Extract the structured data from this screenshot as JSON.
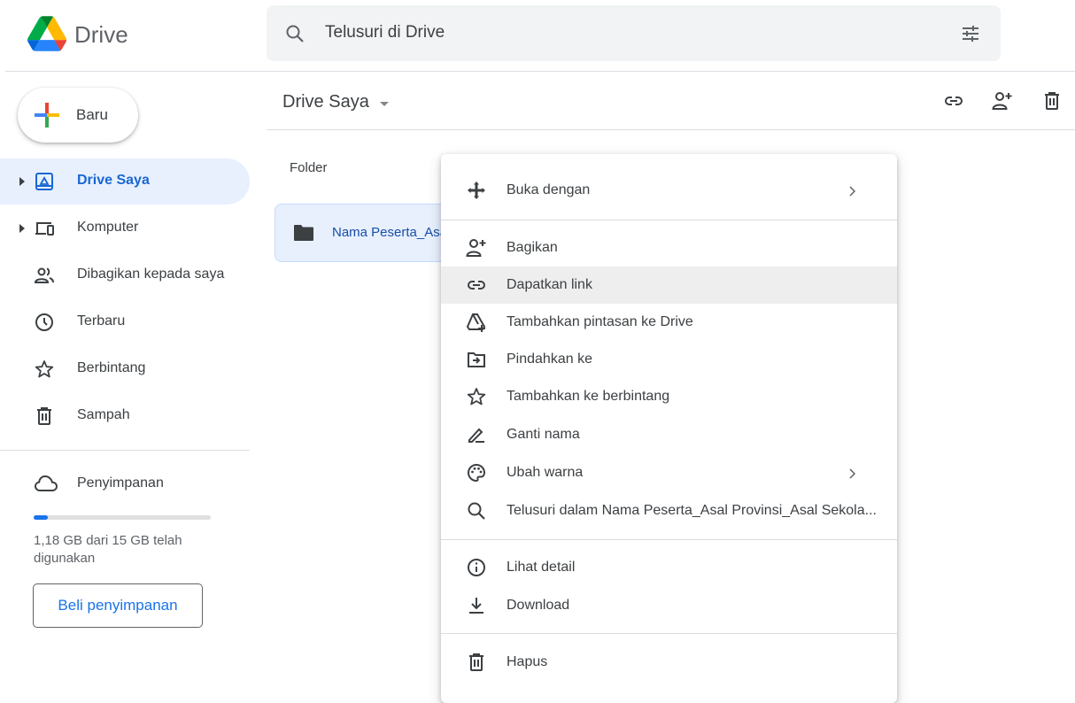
{
  "app": {
    "name": "Drive"
  },
  "search": {
    "placeholder": "Telusuri di Drive"
  },
  "sidebar": {
    "new_label": "Baru",
    "items": [
      {
        "label": "Drive Saya"
      },
      {
        "label": "Komputer"
      },
      {
        "label": "Dibagikan kepada saya"
      },
      {
        "label": "Terbaru"
      },
      {
        "label": "Berbintang"
      },
      {
        "label": "Sampah"
      }
    ],
    "storage": {
      "label": "Penyimpanan",
      "usage_text": "1,18 GB dari 15 GB telah digunakan",
      "used_fraction": 0.079,
      "buy_label": "Beli penyimpanan"
    }
  },
  "main": {
    "breadcrumb": "Drive Saya",
    "section_header": "Folder",
    "folder_name": "Nama Peserta_Asal Provinsi_Asal Sekolah"
  },
  "menu": {
    "items": [
      {
        "label": "Buka dengan",
        "icon": "open-with-icon"
      },
      {
        "label": "Bagikan",
        "icon": "share-icon"
      },
      {
        "label": "Dapatkan link",
        "icon": "link-icon"
      },
      {
        "label": "Tambahkan pintasan ke Drive",
        "icon": "add-shortcut-icon"
      },
      {
        "label": "Pindahkan ke",
        "icon": "move-to-icon"
      },
      {
        "label": "Tambahkan ke berbintang",
        "icon": "star-icon"
      },
      {
        "label": "Ganti nama",
        "icon": "rename-icon"
      },
      {
        "label": "Ubah warna",
        "icon": "palette-icon"
      },
      {
        "label": "Telusuri dalam Nama Peserta_Asal Provinsi_Asal Sekola...",
        "icon": "search-icon"
      },
      {
        "label": "Lihat detail",
        "icon": "info-icon"
      },
      {
        "label": "Download",
        "icon": "download-icon"
      },
      {
        "label": "Hapus",
        "icon": "trash-icon"
      }
    ]
  },
  "colors": {
    "accent": "#1a73e8",
    "active_bg": "#e8f0fe",
    "hover_bg": "#eeeeee"
  }
}
